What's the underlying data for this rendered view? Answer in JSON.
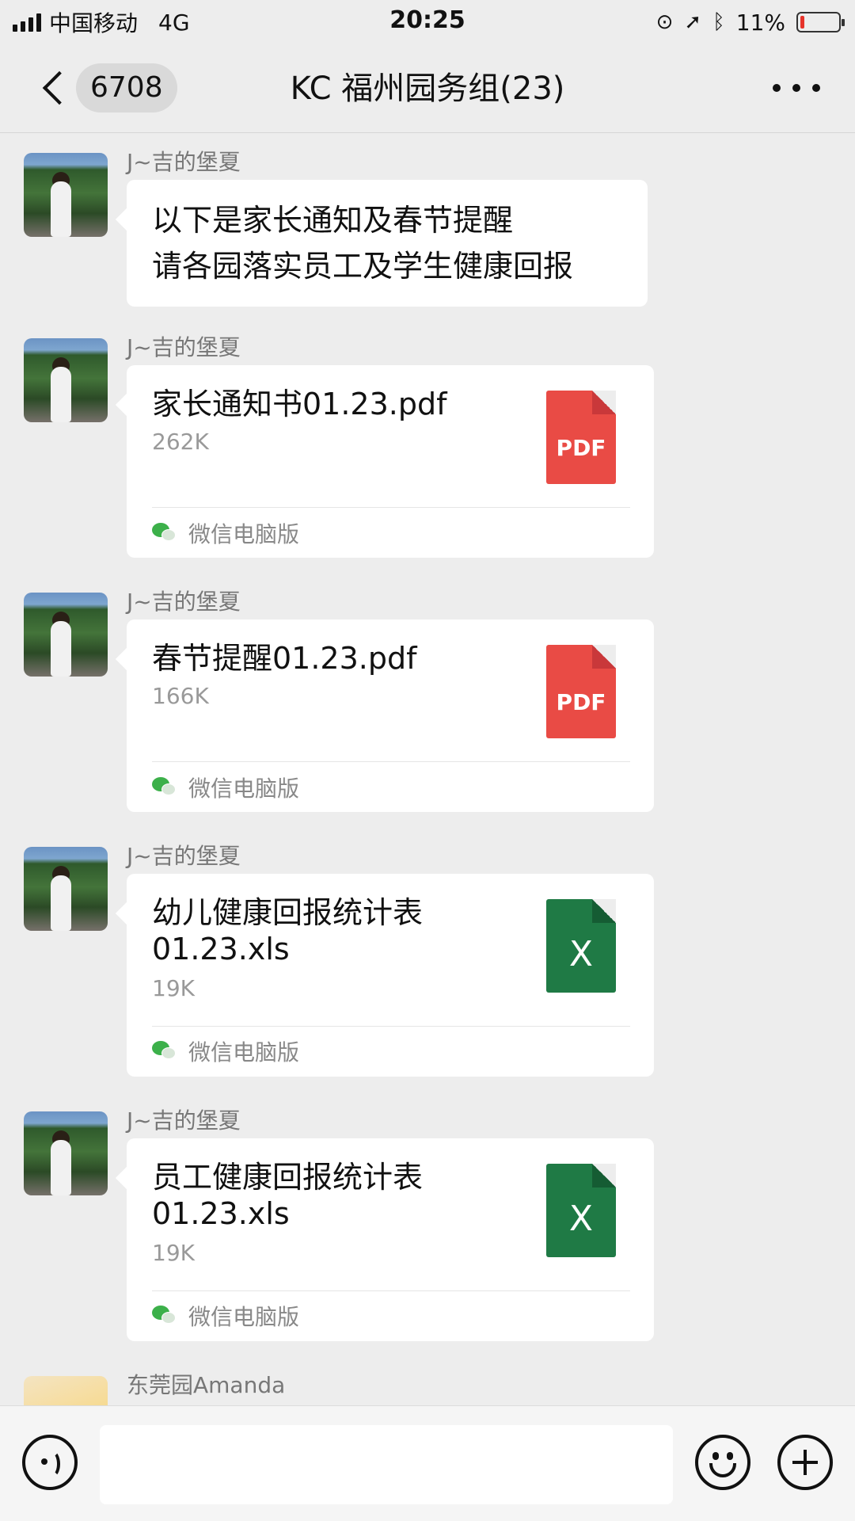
{
  "status_bar": {
    "carrier": "中国移动",
    "network": "4G",
    "time": "20:25",
    "battery_percent_label": "11%",
    "battery_level": 0.11,
    "battery_color": "#e6332a",
    "icons": [
      "signal-icon",
      "orientation-lock-icon",
      "location-icon",
      "bluetooth-icon",
      "battery-icon"
    ]
  },
  "nav": {
    "back_icon": "chevron-left-icon",
    "unread_count": "6708",
    "title": "KC  福州园务组(23)",
    "more_icon": "more-dots-icon"
  },
  "messages": [
    {
      "type": "text",
      "sender": "J~吉的堡夏",
      "lines": [
        "以下是家长通知及春节提醒",
        "请各园落实员工及学生健康回报"
      ]
    },
    {
      "type": "file",
      "sender": "J~吉的堡夏",
      "file_name": "家长通知书01.23.pdf",
      "file_size": "262K",
      "file_type": "pdf",
      "file_glyph": "PDF",
      "source": "微信电脑版"
    },
    {
      "type": "file",
      "sender": "J~吉的堡夏",
      "file_name": "春节提醒01.23.pdf",
      "file_size": "166K",
      "file_type": "pdf",
      "file_glyph": "PDF",
      "source": "微信电脑版"
    },
    {
      "type": "file",
      "sender": "J~吉的堡夏",
      "file_name": "幼儿健康回报统计表01.23.xls",
      "file_size": "19K",
      "file_type": "xls",
      "file_glyph": "X",
      "source": "微信电脑版"
    },
    {
      "type": "file",
      "sender": "J~吉的堡夏",
      "file_name": "员工健康回报统计表01.23.xls",
      "file_size": "19K",
      "file_type": "xls",
      "file_glyph": "X",
      "source": "微信电脑版"
    },
    {
      "type": "partial",
      "sender": "东莞园Amanda"
    }
  ],
  "input_bar": {
    "voice_icon": "voice-icon",
    "message_value": "",
    "emoji_icon": "emoji-icon",
    "plus_icon": "plus-icon"
  },
  "colors": {
    "pdf": "#e94b45",
    "xls": "#1f7a45",
    "wechat_green": "#3cb04a",
    "background": "#ededed"
  }
}
